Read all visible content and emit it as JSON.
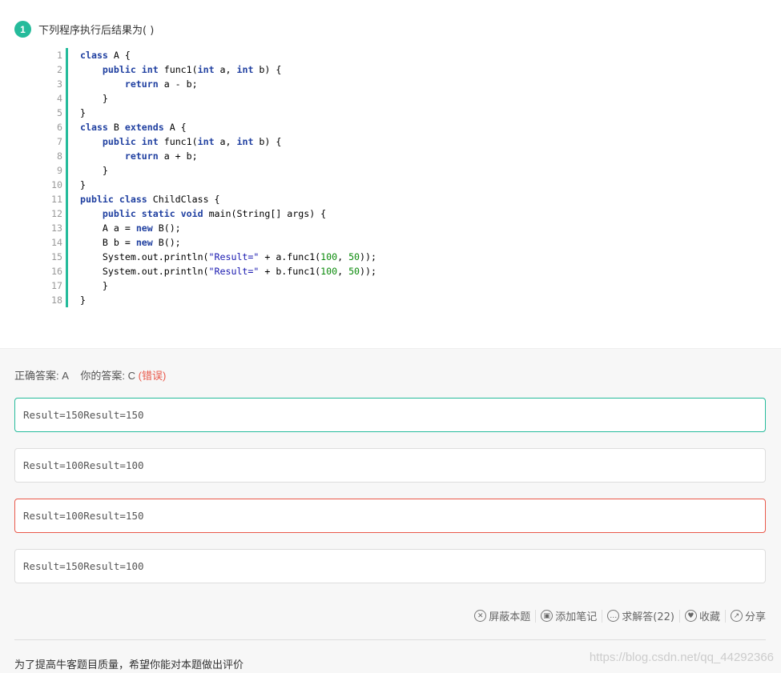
{
  "question": {
    "number": "1",
    "text": "下列程序执行后结果为( )"
  },
  "code": {
    "line_numbers": [
      "1",
      "2",
      "3",
      "4",
      "5",
      "6",
      "7",
      "8",
      "9",
      "10",
      "11",
      "12",
      "13",
      "14",
      "15",
      "16",
      "17",
      "18"
    ],
    "lines": [
      "class A {",
      "    public int func1(int a, int b) {",
      "        return a - b;",
      "    }",
      "}",
      "class B extends A {",
      "    public int func1(int a, int b) {",
      "        return a + b;",
      "    }",
      "}",
      "public class ChildClass {",
      "    public static void main(String[] args) {",
      "    A a = new B();",
      "    B b = new B();",
      "    System.out.println(\"Result=\" + a.func1(100, 50));",
      "    System.out.println(\"Result=\" + b.func1(100, 50));",
      "    }",
      "}"
    ]
  },
  "answer": {
    "correct_label": "正确答案: A",
    "yours_label": "你的答案: C",
    "status": "(错误)"
  },
  "options": [
    "Result=150Result=150",
    "Result=100Result=100",
    "Result=100Result=150",
    "Result=150Result=100"
  ],
  "actions": {
    "hide": "屏蔽本题",
    "note": "添加笔记",
    "solve": "求解答(22)",
    "collect": "收藏",
    "share": "分享"
  },
  "rating_prompt": "为了提高牛客题目质量，希望你能对本题做出评价",
  "watermark": "https://blog.csdn.net/qq_44292366",
  "colors": {
    "accent": "#25bb9b",
    "error": "#e9584a"
  }
}
